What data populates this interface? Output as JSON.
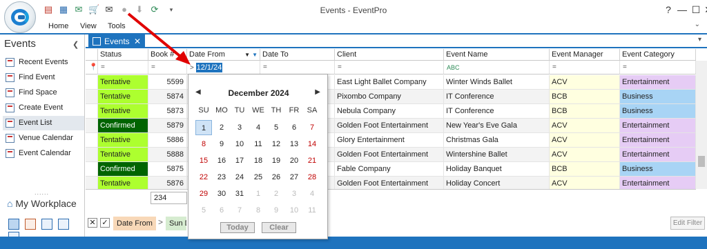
{
  "window": {
    "title": "Events - EventPro"
  },
  "quick_access": [
    "new-event-icon",
    "calendar-icon",
    "email-icon",
    "cart-icon",
    "mail-icon",
    "record-icon",
    "download-icon",
    "refresh-icon",
    "dropdown-icon"
  ],
  "menu": {
    "home": "Home",
    "view": "View",
    "tools": "Tools"
  },
  "nav": {
    "title": "Events",
    "items": [
      {
        "label": "Recent Events",
        "icon": "recent-events-icon"
      },
      {
        "label": "Find Event",
        "icon": "find-event-icon"
      },
      {
        "label": "Find Space",
        "icon": "find-space-icon"
      },
      {
        "label": "Create Event",
        "icon": "create-event-icon"
      },
      {
        "label": "Event List",
        "icon": "event-list-icon",
        "active": true
      },
      {
        "label": "Venue Calendar",
        "icon": "venue-calendar-icon"
      },
      {
        "label": "Event Calendar",
        "icon": "event-calendar-icon"
      }
    ],
    "splitter": "......",
    "workplace": "My Workplace"
  },
  "doc_tab": {
    "label": "Events",
    "close": "✕"
  },
  "grid": {
    "columns": [
      "Status",
      "Book #",
      "Date From",
      "Date To",
      "Client",
      "Event Name",
      "Event Manager",
      "Event Category"
    ],
    "filter_row": {
      "date_from_value": "12/1/24",
      "event_name_value": "ABC"
    },
    "rows": [
      {
        "status": "Tentative",
        "book": "5599",
        "client": "East Light Ballet Company",
        "event": "Winter Winds Ballet",
        "manager": "ACV",
        "category": "Entertainment"
      },
      {
        "status": "Tentative",
        "book": "5874",
        "client": "Pixombo Company",
        "event": "IT Conference",
        "manager": "BCB",
        "category": "Business"
      },
      {
        "status": "Tentative",
        "book": "5873",
        "client": "Nebula Company",
        "event": "IT Conference",
        "manager": "BCB",
        "category": "Business"
      },
      {
        "status": "Confirmed",
        "book": "5879",
        "client": "Golden Foot Entertainment",
        "event": "New Year's Eve Gala",
        "manager": "ACV",
        "category": "Entertainment"
      },
      {
        "status": "Tentative",
        "book": "5886",
        "client": "Glory Entertainment",
        "event": "Christmas Gala",
        "manager": "ACV",
        "category": "Entertainment"
      },
      {
        "status": "Tentative",
        "book": "5888",
        "client": "Golden Foot Entertainment",
        "event": "Wintershine Ballet",
        "manager": "ACV",
        "category": "Entertainment"
      },
      {
        "status": "Confirmed",
        "book": "5875",
        "client": "Fable Company",
        "event": "Holiday Banquet",
        "manager": "BCB",
        "category": "Business"
      },
      {
        "status": "Tentative",
        "book": "5876",
        "client": "Golden Foot Entertainment",
        "event": "Holiday Concert",
        "manager": "ACV",
        "category": "Entertainment"
      }
    ],
    "footer_count": "234"
  },
  "filter_bar": {
    "chip1": "Date From",
    "separator": ">",
    "chip2": "Sun D",
    "edit_filter": "Edit Filter"
  },
  "calendar": {
    "month_title": "December 2024",
    "days_of_week": [
      "SU",
      "MO",
      "TU",
      "WE",
      "TH",
      "FR",
      "SA"
    ],
    "weeks": [
      [
        "1",
        "2",
        "3",
        "4",
        "5",
        "6",
        "7"
      ],
      [
        "8",
        "9",
        "10",
        "11",
        "12",
        "13",
        "14"
      ],
      [
        "15",
        "16",
        "17",
        "18",
        "19",
        "20",
        "21"
      ],
      [
        "22",
        "23",
        "24",
        "25",
        "26",
        "27",
        "28"
      ],
      [
        "29",
        "30",
        "31",
        "1",
        "2",
        "3",
        "4"
      ],
      [
        "5",
        "6",
        "7",
        "8",
        "9",
        "10",
        "11"
      ]
    ],
    "selected_day": "1",
    "today_label": "Today",
    "clear_label": "Clear"
  },
  "colors": {
    "tentative": "#adff2f",
    "confirmed": "#006400",
    "manager": "#ffffe0",
    "entertainment": "#e6ccf5",
    "business": "#a8d4f5",
    "accent": "#1e73be",
    "weekend_red": "#c00000",
    "annotation_arrow": "#e00000"
  }
}
